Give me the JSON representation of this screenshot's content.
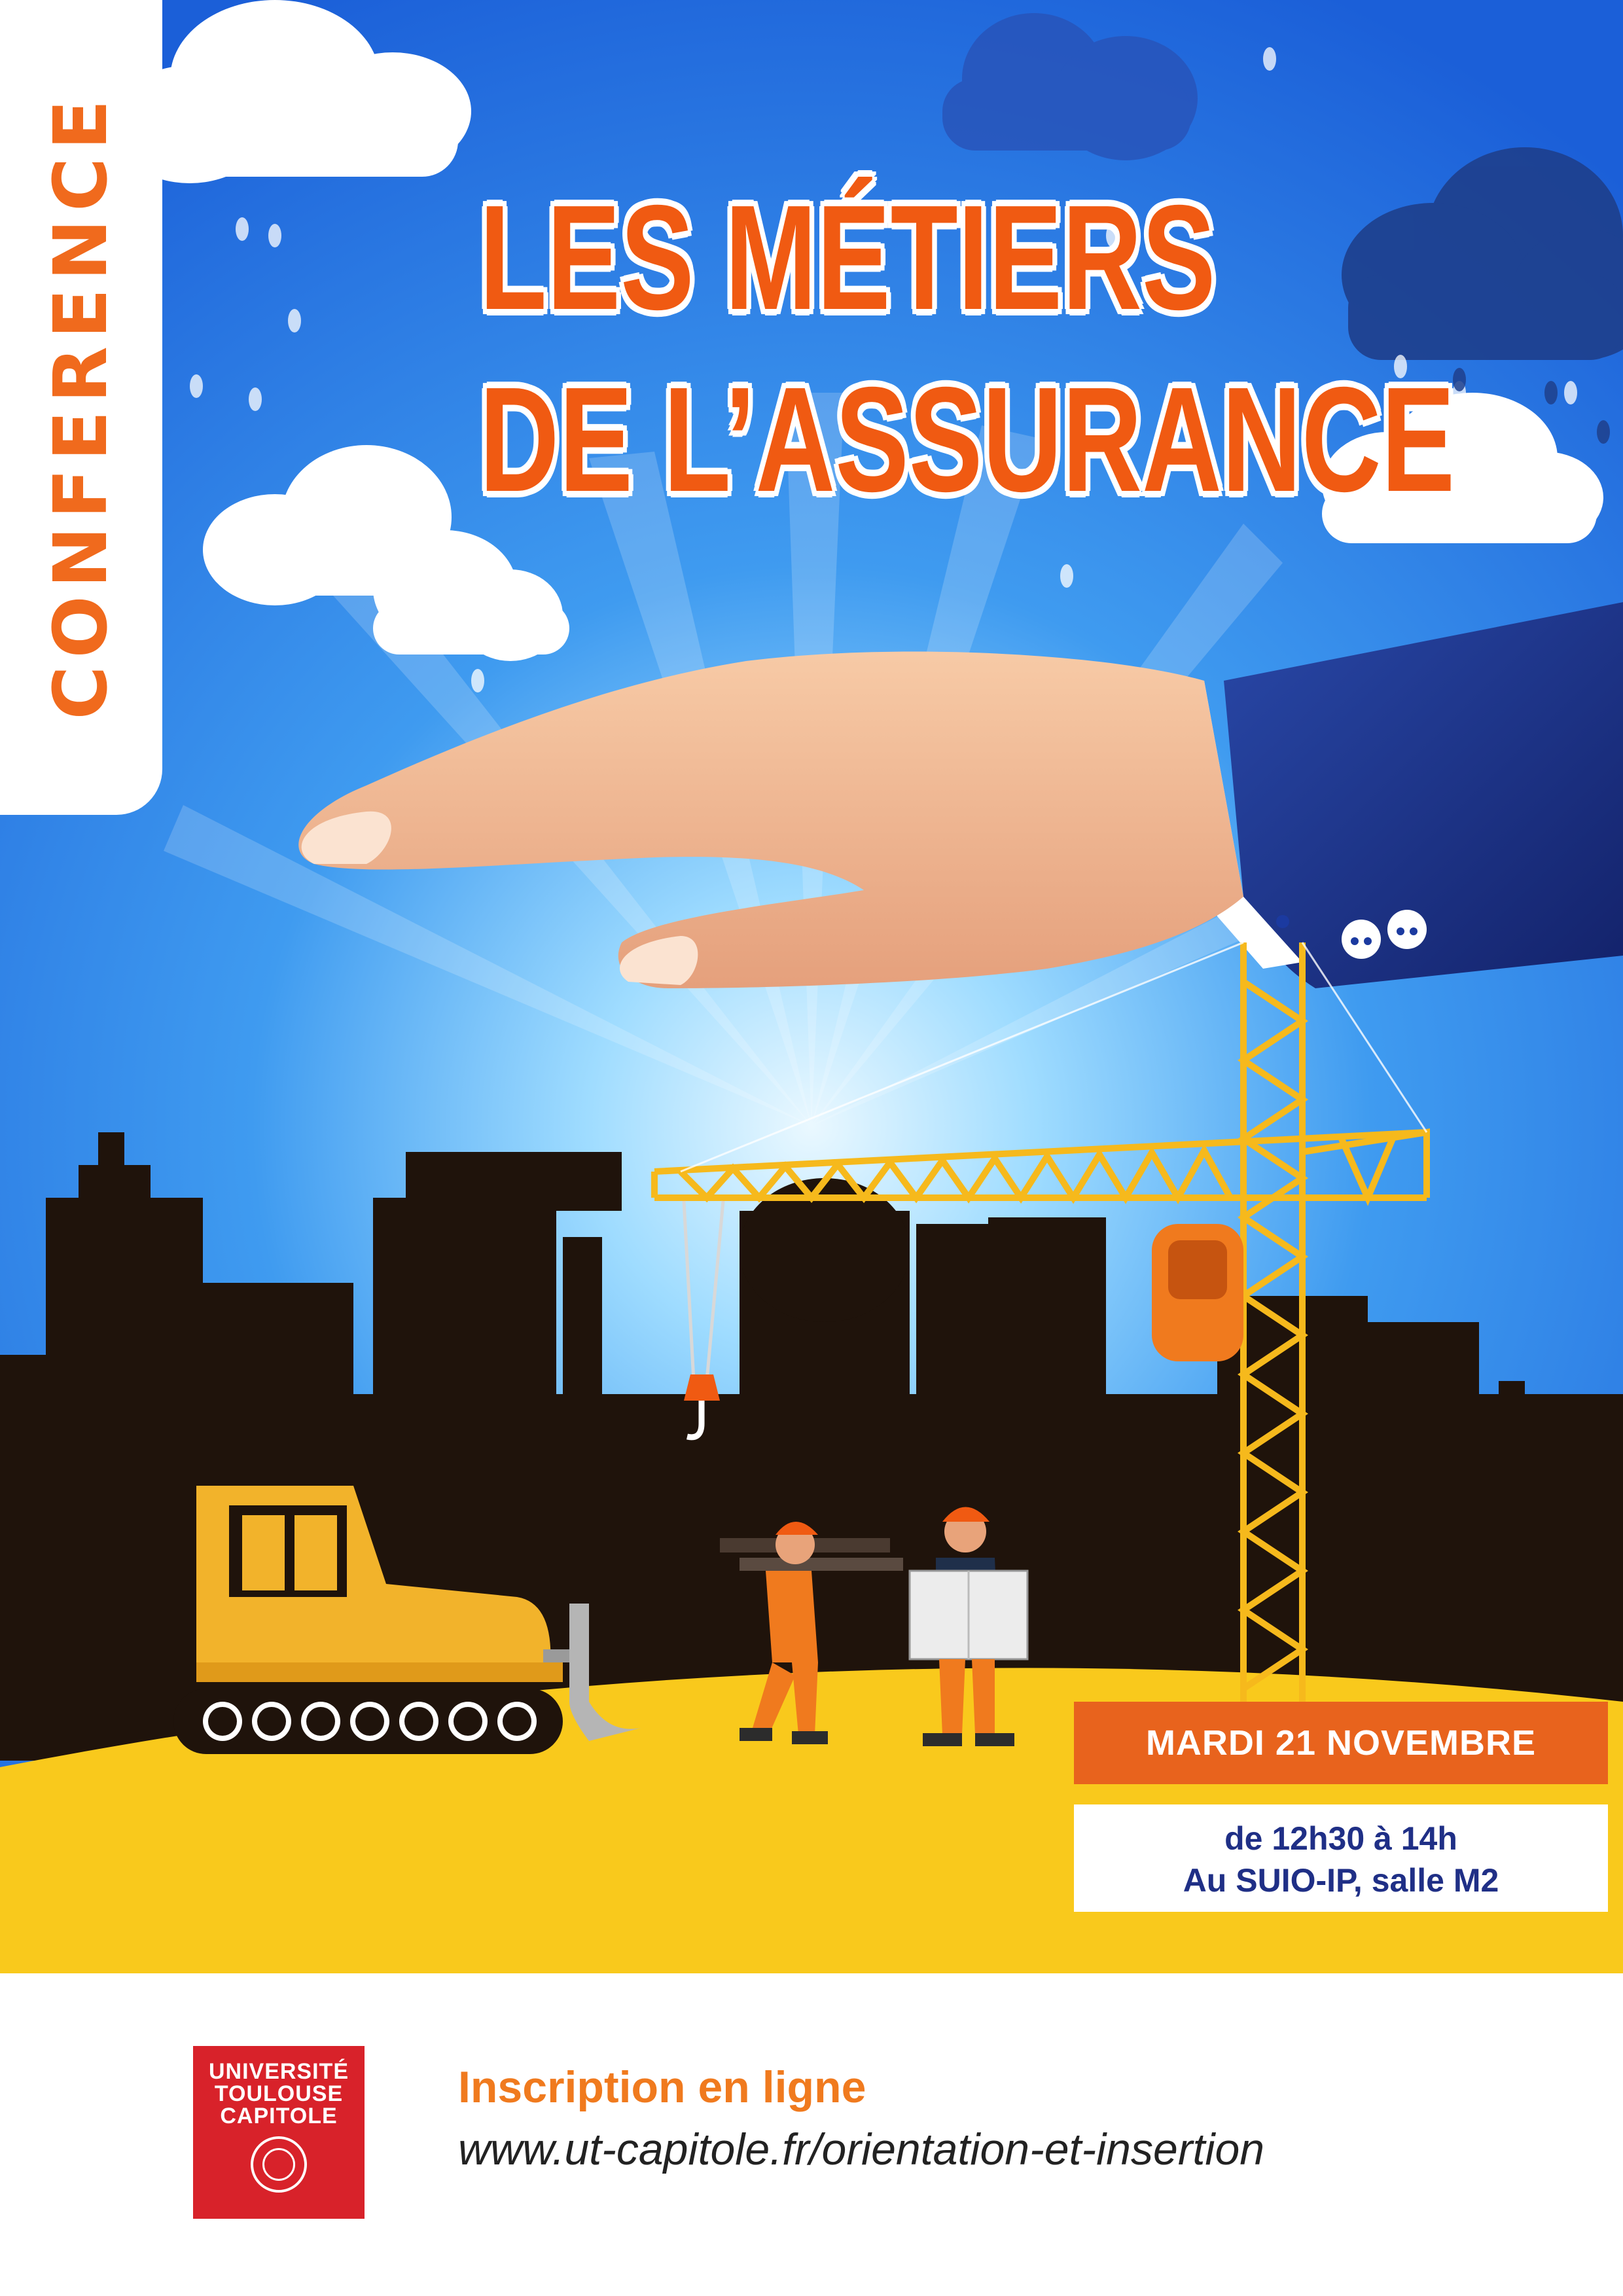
{
  "event": {
    "type_label": "CONFERENCE",
    "title_line1": "LES MÉTIERS",
    "title_line2": "DE L’ASSURANCE",
    "date": "MARDI 21 NOVEMBRE",
    "time": "de 12h30 à 14h",
    "place": "Au SUIO-IP, salle M2"
  },
  "footer": {
    "logo_lines": [
      "UNIVERSITÉ",
      "TOULOUSE",
      "CAPITOLE"
    ],
    "registration_title": "Inscription en ligne",
    "registration_url": "www.ut-capitole.fr/orientation-et-insertion"
  },
  "colors": {
    "sky_top": "#1f64dc",
    "sky_glow": "#bfe8ff",
    "ground": "#f9c91c",
    "skyline": "#1f130b",
    "accent_orange": "#f05a12",
    "navy": "#1f2f86",
    "logo_red": "#d8222a"
  },
  "icons": [
    "hand-illustration",
    "crane-illustration",
    "bulldozer-illustration",
    "worker-illustration",
    "cloud-icon"
  ]
}
